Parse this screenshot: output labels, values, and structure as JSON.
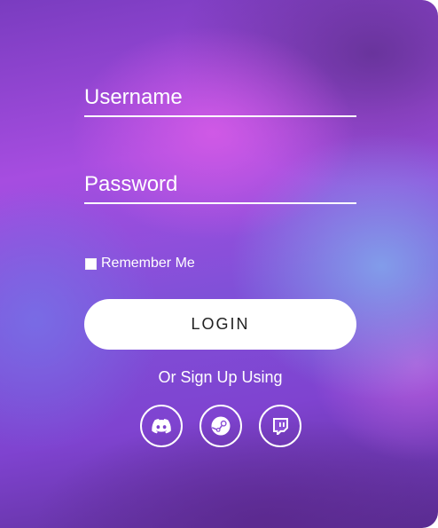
{
  "form": {
    "username_placeholder": "Username",
    "password_placeholder": "Password",
    "remember_label": "Remember Me",
    "remember_checked": false,
    "login_label": "LOGIN",
    "signup_text": "Or Sign Up Using"
  },
  "socials": [
    {
      "icon": "discord-icon"
    },
    {
      "icon": "steam-icon"
    },
    {
      "icon": "twitch-icon"
    }
  ],
  "colors": {
    "accent": "#ffffff",
    "background_top": "#a64de0",
    "background_mid": "#8050d8",
    "button_text": "#222222"
  }
}
